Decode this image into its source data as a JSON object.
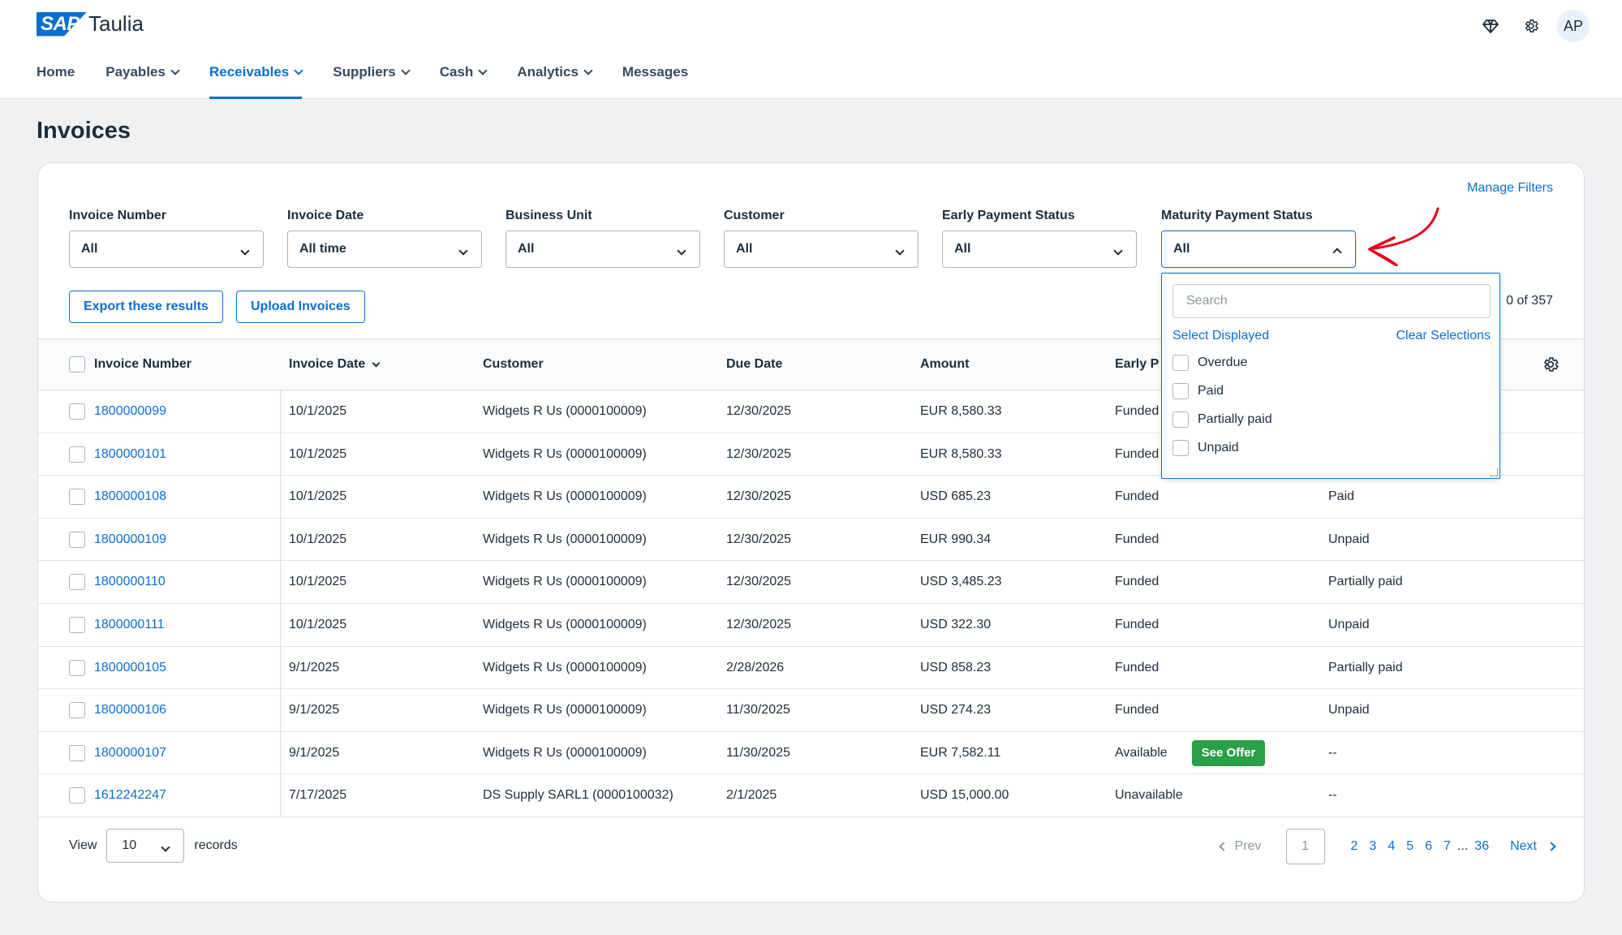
{
  "app": {
    "logo_text": "SAP",
    "brand": "Taulia",
    "avatar": "AP"
  },
  "nav": [
    {
      "label": "Home",
      "dropdown": false,
      "active": false
    },
    {
      "label": "Payables",
      "dropdown": true,
      "active": false
    },
    {
      "label": "Receivables",
      "dropdown": true,
      "active": true
    },
    {
      "label": "Suppliers",
      "dropdown": true,
      "active": false
    },
    {
      "label": "Cash",
      "dropdown": true,
      "active": false
    },
    {
      "label": "Analytics",
      "dropdown": true,
      "active": false
    },
    {
      "label": "Messages",
      "dropdown": false,
      "active": false
    }
  ],
  "page": {
    "title": "Invoices"
  },
  "filters": {
    "manage_label": "Manage Filters",
    "items": [
      {
        "label": "Invoice Number",
        "value": "All"
      },
      {
        "label": "Invoice Date",
        "value": "All time"
      },
      {
        "label": "Business Unit",
        "value": "All"
      },
      {
        "label": "Customer",
        "value": "All"
      },
      {
        "label": "Early Payment Status",
        "value": "All"
      },
      {
        "label": "Maturity Payment Status",
        "value": "All"
      }
    ]
  },
  "actions": {
    "export": "Export these results",
    "upload": "Upload Invoices"
  },
  "records_count": "0 of 357",
  "table": {
    "headers": {
      "invoice_number": "Invoice Number",
      "invoice_date": "Invoice Date",
      "customer": "Customer",
      "due_date": "Due Date",
      "amount": "Amount",
      "early_payment": "Early P"
    },
    "rows": [
      {
        "number": "1800000099",
        "date": "10/1/2025",
        "customer": "Widgets R Us (0000100009)",
        "due": "12/30/2025",
        "amount": "EUR 8,580.33",
        "early": "Funded",
        "maturity": ""
      },
      {
        "number": "1800000101",
        "date": "10/1/2025",
        "customer": "Widgets R Us (0000100009)",
        "due": "12/30/2025",
        "amount": "EUR 8,580.33",
        "early": "Funded",
        "maturity": ""
      },
      {
        "number": "1800000108",
        "date": "10/1/2025",
        "customer": "Widgets R Us (0000100009)",
        "due": "12/30/2025",
        "amount": "USD 685.23",
        "early": "Funded",
        "maturity": "Paid"
      },
      {
        "number": "1800000109",
        "date": "10/1/2025",
        "customer": "Widgets R Us (0000100009)",
        "due": "12/30/2025",
        "amount": "EUR 990.34",
        "early": "Funded",
        "maturity": "Unpaid"
      },
      {
        "number": "1800000110",
        "date": "10/1/2025",
        "customer": "Widgets R Us (0000100009)",
        "due": "12/30/2025",
        "amount": "USD 3,485.23",
        "early": "Funded",
        "maturity": "Partially paid"
      },
      {
        "number": "1800000111",
        "date": "10/1/2025",
        "customer": "Widgets R Us (0000100009)",
        "due": "12/30/2025",
        "amount": "USD 322.30",
        "early": "Funded",
        "maturity": "Unpaid"
      },
      {
        "number": "1800000105",
        "date": "9/1/2025",
        "customer": "Widgets R Us (0000100009)",
        "due": "2/28/2026",
        "amount": "USD 858.23",
        "early": "Funded",
        "maturity": "Partially paid"
      },
      {
        "number": "1800000106",
        "date": "9/1/2025",
        "customer": "Widgets R Us (0000100009)",
        "due": "11/30/2025",
        "amount": "USD 274.23",
        "early": "Funded",
        "maturity": "Unpaid"
      },
      {
        "number": "1800000107",
        "date": "9/1/2025",
        "customer": "Widgets R Us (0000100009)",
        "due": "11/30/2025",
        "amount": "EUR 7,582.11",
        "early": "Available",
        "offer": "See Offer",
        "maturity": "--"
      },
      {
        "number": "1612242247",
        "date": "7/17/2025",
        "customer": "DS Supply SARL1 (0000100032)",
        "due": "2/1/2025",
        "amount": "USD 15,000.00",
        "early": "Unavailable",
        "maturity": "--"
      }
    ]
  },
  "footer": {
    "view_label": "View",
    "page_size": "10",
    "records_label": "records",
    "prev": "Prev",
    "current_page": "1",
    "pages": [
      "2",
      "3",
      "4",
      "5",
      "6",
      "7"
    ],
    "ellipsis": "...",
    "last_page": "36",
    "next": "Next"
  },
  "dropdown": {
    "search_placeholder": "Search",
    "select_displayed": "Select Displayed",
    "clear_selections": "Clear Selections",
    "options": [
      "Overdue",
      "Paid",
      "Partially paid",
      "Unpaid"
    ]
  },
  "colors": {
    "accent": "#0a6ed1",
    "success": "#2b9f46",
    "annotation": "#e3001b"
  },
  "icons": {
    "diamond": "diamond-icon",
    "settings": "gear-icon"
  }
}
